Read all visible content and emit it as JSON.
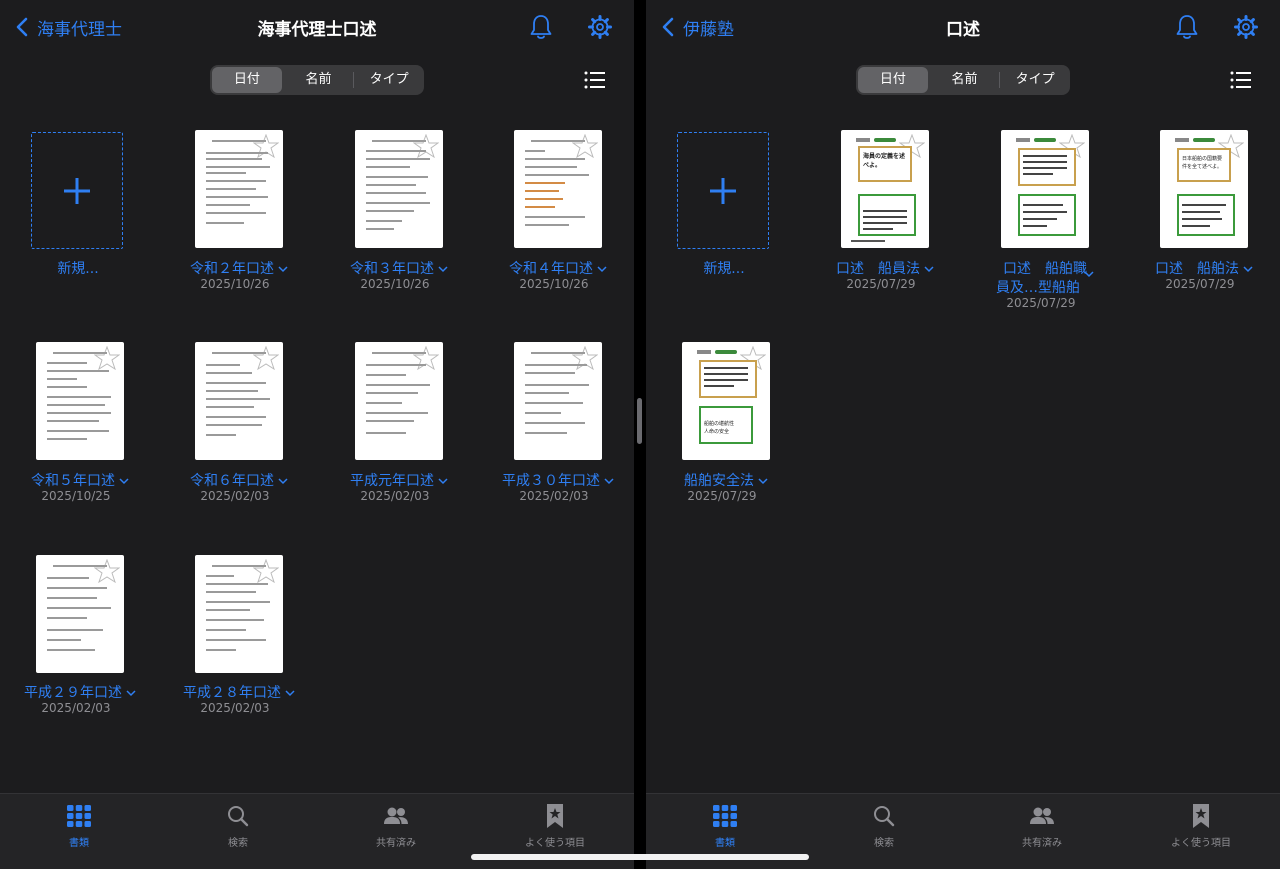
{
  "colors": {
    "accent": "#2f7ff3",
    "background": "#1c1c1e",
    "text": "#ffffff",
    "muted": "#8e8e93"
  },
  "left": {
    "back_label": "海事代理士",
    "title": "海事代理士口述",
    "segments": [
      "日付",
      "名前",
      "タイプ"
    ],
    "selected_segment": "日付",
    "new_label": "新規...",
    "documents": [
      {
        "name": "令和２年口述",
        "date": "2025/10/26"
      },
      {
        "name": "令和３年口述",
        "date": "2025/10/26"
      },
      {
        "name": "令和４年口述",
        "date": "2025/10/26"
      },
      {
        "name": "令和５年口述",
        "date": "2025/10/25"
      },
      {
        "name": "令和６年口述",
        "date": "2025/02/03"
      },
      {
        "name": "平成元年口述",
        "date": "2025/02/03"
      },
      {
        "name": "平成３０年口述",
        "date": "2025/02/03"
      },
      {
        "name": "平成２９年口述",
        "date": "2025/02/03"
      },
      {
        "name": "平成２８年口述",
        "date": "2025/02/03"
      }
    ],
    "tabs": [
      "書類",
      "検索",
      "共有済み",
      "よく使う項目"
    ]
  },
  "right": {
    "back_label": "伊藤塾",
    "title": "口述",
    "segments": [
      "日付",
      "名前",
      "タイプ"
    ],
    "selected_segment": "日付",
    "new_label": "新規...",
    "documents": [
      {
        "name": "口述　船員法",
        "date": "2025/07/29",
        "card_title": "海員の定義を述べよ。"
      },
      {
        "name_line1": "口述　船舶職",
        "name_line2": "員及…型船舶",
        "date": "2025/07/29"
      },
      {
        "name": "口述　船舶法",
        "date": "2025/07/29",
        "card_title": "日本船舶の国籍要件を全て述べよ。"
      },
      {
        "name": "船舶安全法",
        "date": "2025/07/29",
        "card_items": [
          "船舶の堪航性",
          "人命の安全"
        ]
      }
    ],
    "tabs": [
      "書類",
      "検索",
      "共有済み",
      "よく使う項目"
    ]
  },
  "icons": {
    "back": "chevron-left-icon",
    "bell": "bell-icon",
    "gear": "gear-icon",
    "list": "list-icon",
    "plus": "plus-icon",
    "dropdown": "chevron-down-icon",
    "tab_icons": [
      "grid-icon",
      "magnifier-icon",
      "people-icon",
      "bookmark-star-icon"
    ]
  }
}
